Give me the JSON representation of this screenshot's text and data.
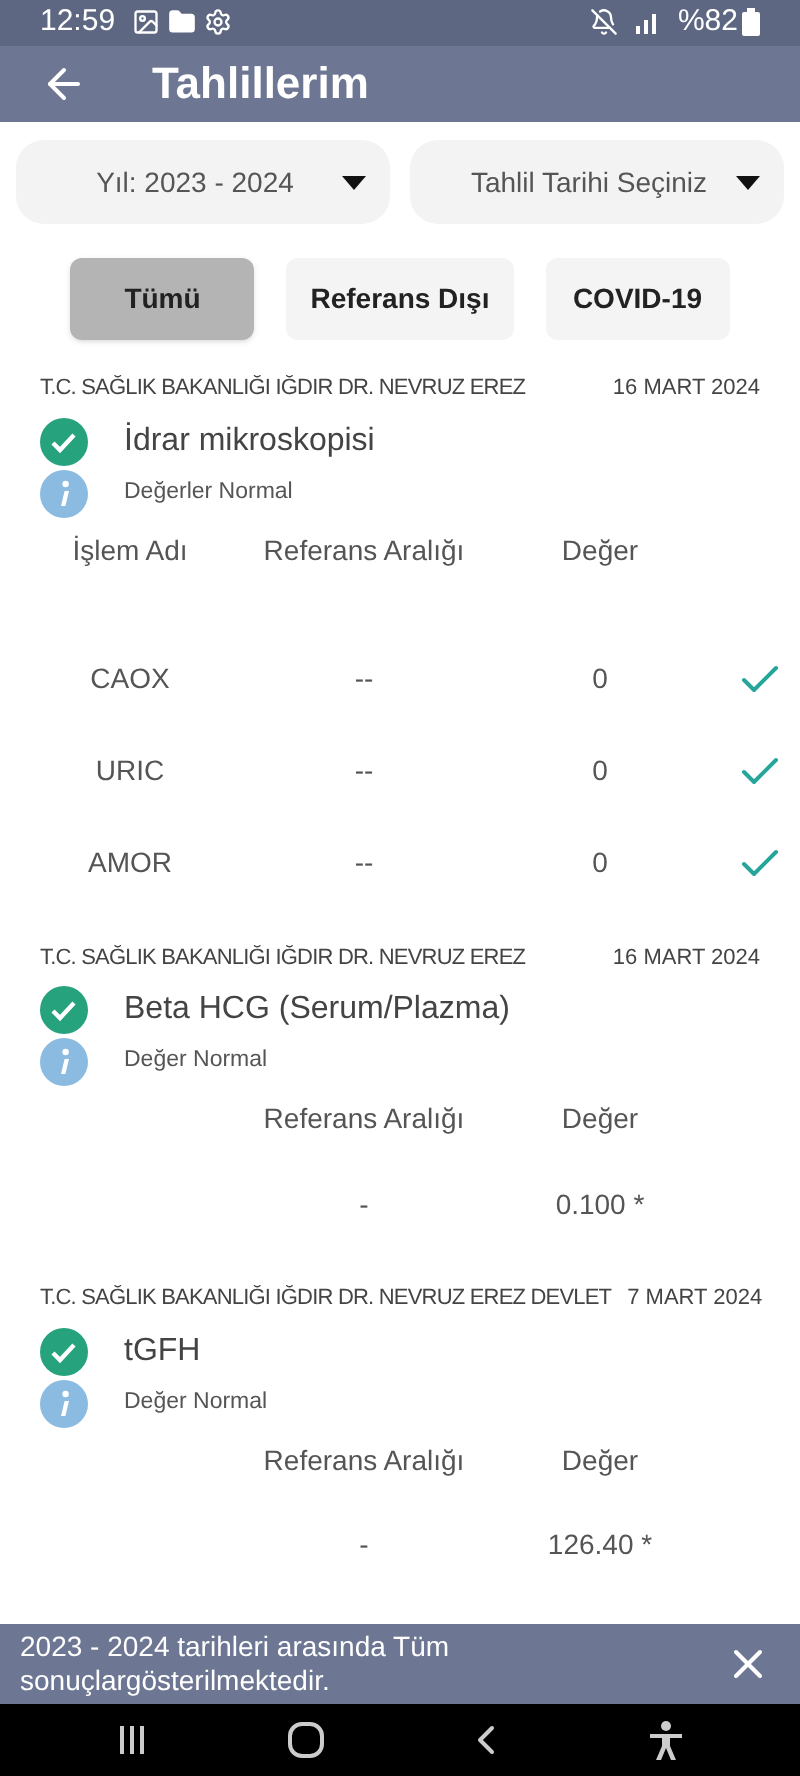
{
  "status_bar": {
    "time": "12:59",
    "battery": "%82"
  },
  "app_bar": {
    "title": "Tahlillerim"
  },
  "dropdowns": [
    {
      "label": "Yıl: 2023 - 2024"
    },
    {
      "label": "Tahlil Tarihi Seçiniz"
    }
  ],
  "filters": [
    {
      "label": "Tümü",
      "selected": true
    },
    {
      "label": "Referans Dışı",
      "selected": false
    },
    {
      "label": "COVID-19",
      "selected": false
    }
  ],
  "results": [
    {
      "institution": "T.C. SAĞLIK BAKANLIĞI IĞDIR DR. NEVRUZ EREZ",
      "date": "16 MART 2024",
      "test": "İdrar mikroskopisi",
      "note": "Değerler Normal",
      "columns": {
        "name": "İşlem Adı",
        "range": "Referans Aralığı",
        "value": "Değer"
      },
      "rows": [
        {
          "name": "CAOX",
          "range": "--",
          "value": "0",
          "checked": true
        },
        {
          "name": "URIC",
          "range": "--",
          "value": "0",
          "checked": true
        },
        {
          "name": "AMOR",
          "range": "--",
          "value": "0",
          "checked": true
        }
      ]
    },
    {
      "institution": "T.C. SAĞLIK BAKANLIĞI IĞDIR DR. NEVRUZ EREZ",
      "date": "16 MART 2024",
      "test": "Beta HCG (Serum/Plazma)",
      "note": "Değer Normal",
      "columns": {
        "range": "Referans Aralığı",
        "value": "Değer"
      },
      "rows": [
        {
          "range": "-",
          "value": "0.100 *"
        }
      ]
    },
    {
      "institution": "T.C. SAĞLIK BAKANLIĞI IĞDIR DR. NEVRUZ EREZ DEVLET",
      "date": "7 MART 2024",
      "test": "tGFH",
      "note": "Değer Normal",
      "columns": {
        "range": "Referans Aralığı",
        "value": "Değer"
      },
      "rows": [
        {
          "range": "-",
          "value": "126.40 *"
        }
      ]
    }
  ],
  "snackbar": {
    "message": "2023 - 2024 tarihleri arasında Tüm sonuçlargösterilmektedir."
  }
}
